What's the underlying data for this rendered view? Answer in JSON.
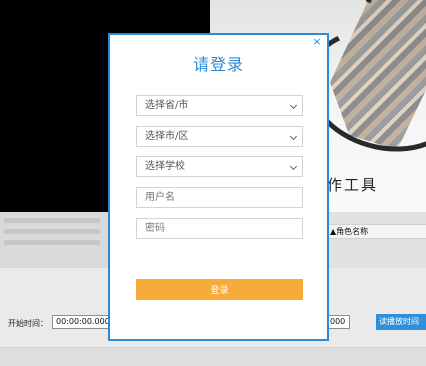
{
  "background": {
    "tool_title": "作工具",
    "table_column": "▲角色名称",
    "start_time_label": "开始时间：",
    "start_time_value": "00:00:00.000",
    "end_time_value": "000",
    "read_button": "读播放时间"
  },
  "dialog": {
    "title": "请登录",
    "close_label": "×",
    "province_select": "选择省/市",
    "city_select": "选择市/区",
    "school_select": "选择学校",
    "username_placeholder": "用户名",
    "password_placeholder": "密码",
    "login_button": "登录"
  },
  "colors": {
    "accent": "#2c8ad6",
    "login_button": "#f7ab3a",
    "blue_button": "#2f8fd8"
  }
}
